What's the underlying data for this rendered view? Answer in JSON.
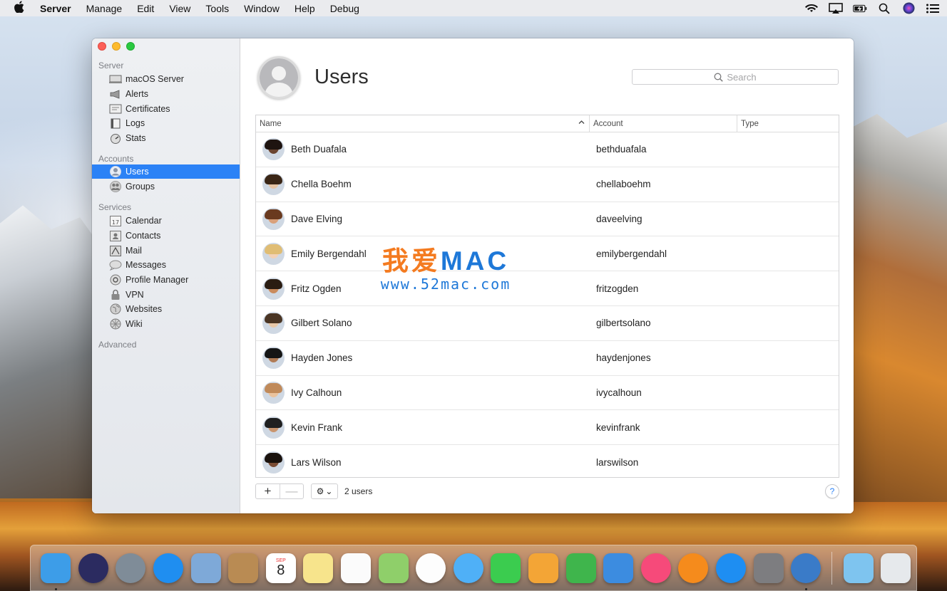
{
  "menubar": {
    "app_name": "Server",
    "items": [
      "Manage",
      "Edit",
      "View",
      "Tools",
      "Window",
      "Help",
      "Debug"
    ],
    "status_icons": [
      "wifi-icon",
      "airplay-icon",
      "battery-icon",
      "spotlight-icon",
      "siri-icon",
      "notification-center-icon"
    ]
  },
  "sidebar": {
    "sections": [
      {
        "title": "Server",
        "items": [
          {
            "label": "macOS Server",
            "icon": "server-icon"
          },
          {
            "label": "Alerts",
            "icon": "megaphone-icon"
          },
          {
            "label": "Certificates",
            "icon": "certificate-icon"
          },
          {
            "label": "Logs",
            "icon": "log-icon"
          },
          {
            "label": "Stats",
            "icon": "stats-icon"
          }
        ]
      },
      {
        "title": "Accounts",
        "items": [
          {
            "label": "Users",
            "icon": "user-icon",
            "selected": true
          },
          {
            "label": "Groups",
            "icon": "group-icon"
          }
        ]
      },
      {
        "title": "Services",
        "items": [
          {
            "label": "Calendar",
            "icon": "calendar-icon"
          },
          {
            "label": "Contacts",
            "icon": "contacts-icon"
          },
          {
            "label": "Mail",
            "icon": "mail-icon"
          },
          {
            "label": "Messages",
            "icon": "messages-icon"
          },
          {
            "label": "Profile Manager",
            "icon": "profile-manager-icon"
          },
          {
            "label": "VPN",
            "icon": "vpn-icon"
          },
          {
            "label": "Websites",
            "icon": "globe-icon"
          },
          {
            "label": "Wiki",
            "icon": "wiki-icon"
          }
        ]
      },
      {
        "title": "Advanced",
        "items": []
      }
    ]
  },
  "main": {
    "title": "Users",
    "search_placeholder": "Search",
    "columns": {
      "name": "Name",
      "account": "Account",
      "type": "Type"
    },
    "users": [
      {
        "name": "Beth Duafala",
        "account": "bethduafala",
        "skin": "#6b4430",
        "hair": "#1e1410"
      },
      {
        "name": "Chella Boehm",
        "account": "chellaboehm",
        "skin": "#e6c4a4",
        "hair": "#3a2616"
      },
      {
        "name": "Dave Elving",
        "account": "daveelving",
        "skin": "#d9a07a",
        "hair": "#6a3a1f"
      },
      {
        "name": "Emily Bergendahl",
        "account": "emilybergendahl",
        "skin": "#f2d1b6",
        "hair": "#e0bd74"
      },
      {
        "name": "Fritz Ogden",
        "account": "fritzogden",
        "skin": "#c98a5c",
        "hair": "#2a1c12"
      },
      {
        "name": "Gilbert Solano",
        "account": "gilbertsolano",
        "skin": "#e8c8a8",
        "hair": "#4a3524"
      },
      {
        "name": "Hayden Jones",
        "account": "haydenjones",
        "skin": "#b07b55",
        "hair": "#151515"
      },
      {
        "name": "Ivy Calhoun",
        "account": "ivycalhoun",
        "skin": "#eac39e",
        "hair": "#c08a5a"
      },
      {
        "name": "Kevin Frank",
        "account": "kevinfrank",
        "skin": "#c9956e",
        "hair": "#202020"
      },
      {
        "name": "Lars Wilson",
        "account": "larswilson",
        "skin": "#7a4c34",
        "hair": "#1a120d"
      }
    ],
    "user_count_label": "2 users",
    "add_label": "+",
    "remove_label": "—",
    "gear_label": "⚙",
    "gear_chevron": "⌄",
    "help_label": "?"
  },
  "watermark": {
    "big_cn": "我爱",
    "big_en": "MAC",
    "url": "www.52mac.com"
  },
  "dock": {
    "calendar_month": "SEP",
    "calendar_day": "8",
    "apps": [
      {
        "name": "finder",
        "color": "#3d9de8",
        "running": true
      },
      {
        "name": "siri",
        "color": "#2b2b60",
        "round": true
      },
      {
        "name": "launchpad",
        "color": "#7f8c98",
        "round": true
      },
      {
        "name": "safari",
        "color": "#1f8ef0",
        "round": true
      },
      {
        "name": "mail-stamp",
        "color": "#7ea9d8"
      },
      {
        "name": "contacts",
        "color": "#b98b53"
      },
      {
        "name": "calendar",
        "color": "#ffffff"
      },
      {
        "name": "notes",
        "color": "#f7e48c"
      },
      {
        "name": "reminders",
        "color": "#fbfbfb"
      },
      {
        "name": "maps",
        "color": "#8fcf6a"
      },
      {
        "name": "photos",
        "color": "#fdfdfd",
        "round": true
      },
      {
        "name": "messages",
        "color": "#4fb0f7",
        "round": true
      },
      {
        "name": "facetime",
        "color": "#3bcc4f"
      },
      {
        "name": "pages",
        "color": "#f3a536"
      },
      {
        "name": "numbers",
        "color": "#3fb54c"
      },
      {
        "name": "keynote",
        "color": "#3c8ce0"
      },
      {
        "name": "itunes",
        "color": "#f64a7a",
        "round": true
      },
      {
        "name": "ibooks",
        "color": "#f58b1c",
        "round": true
      },
      {
        "name": "app-store",
        "color": "#1e8ef2",
        "round": true
      },
      {
        "name": "system-preferences",
        "color": "#7d7d80"
      },
      {
        "name": "server",
        "color": "#3a7bc8",
        "round": true,
        "running": true
      }
    ],
    "trailing": [
      {
        "name": "downloads",
        "color": "#7ec4ef"
      },
      {
        "name": "trash",
        "color": "#e6e9ec"
      }
    ]
  },
  "colors": {
    "accent": "#2b82f6",
    "sidebar_bg": "#e9ecf0"
  }
}
